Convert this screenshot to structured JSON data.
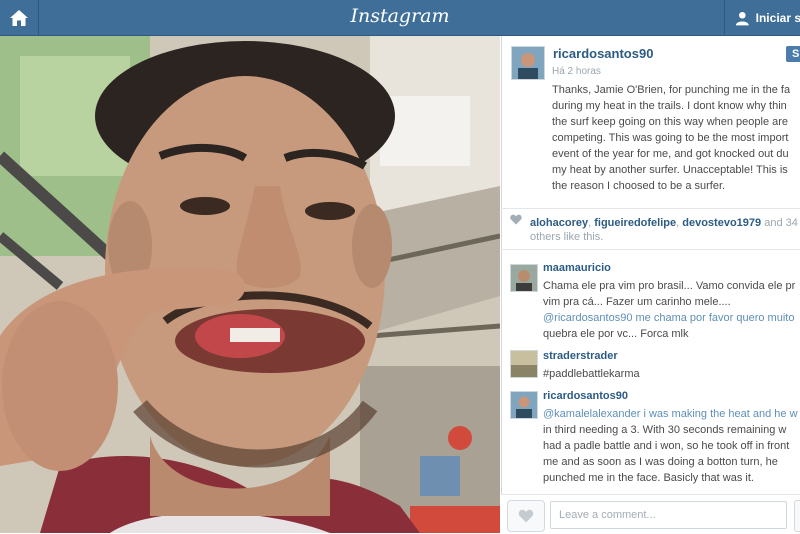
{
  "header": {
    "brand": "Instagram",
    "login_label": "Iniciar s",
    "home_icon": "home-icon",
    "user_icon": "user-icon",
    "bar_color": "#3f6f98"
  },
  "post": {
    "owner": "ricardosantos90",
    "time": "Há 2 horas",
    "follow_label": "S",
    "caption_lines": [
      "Thanks, Jamie O'Brien, for punching me in the fa",
      "during my heat in the trails. I dont know why thin",
      "the surf keep going on this way when people are",
      "competing. This was going to be the most import",
      "event of the year for me, and got knocked out du",
      "my heat by another surfer. Unacceptable! This is",
      "the reason I choosed to be a surfer."
    ],
    "likes": {
      "users": [
        "alohacorey",
        "figueiredofelipe",
        "devostevo1979"
      ],
      "tail": "and 34",
      "line2": "others like this."
    }
  },
  "comments": [
    {
      "user": "maamauricio",
      "lines": [
        "Chama ele pra vim pro brasil... Vamo convida ele pr",
        "vim pra cá... Fazer um carinho mele....",
        "@ricardosantos90 me chama por favor quero muito",
        "quebra ele por vc... Forca mlk"
      ]
    },
    {
      "user": "straderstrader",
      "lines": [
        "#paddlebattlekarma"
      ]
    },
    {
      "user": "ricardosantos90",
      "lines": [
        "@kamalelalexander i was making the heat and he w",
        "in third needing a 3. With 30 seconds remaining w",
        "had a padle battle and i won, so he took off in front",
        "me and as soon as I was doing a botton turn, he",
        "punched me in the face. Basicly that was it."
      ]
    }
  ],
  "footer": {
    "comment_placeholder": "Leave a comment..."
  }
}
